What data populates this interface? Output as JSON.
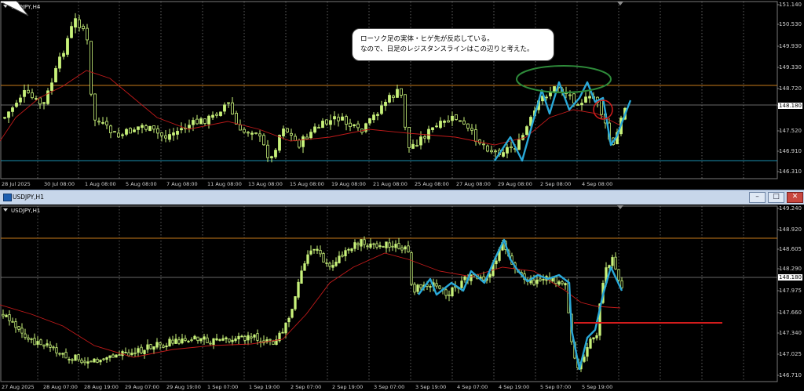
{
  "window_top": {
    "symbol_title": "USDJPY,H4",
    "y_labels": [
      "151.140",
      "150.530",
      "149.930",
      "149.330",
      "148.720",
      "148.180",
      "147.520",
      "146.910",
      "146.310"
    ],
    "current_price": "148.180",
    "x_labels": [
      "28 Jul 2025",
      "30 Jul 08:00",
      "1 Aug 08:00",
      "5 Aug 08:00",
      "7 Aug 08:00",
      "11 Aug 08:00",
      "13 Aug 08:00",
      "15 Aug 08:00",
      "19 Aug 08:00",
      "21 Aug 08:00",
      "25 Aug 08:00",
      "27 Aug 08:00",
      "29 Aug 08:00",
      "2 Sep 08:00",
      "4 Sep 08:00"
    ],
    "annotation_lines": [
      "ローソク足の実体・ヒゲ先が反応している。",
      "なので、日足のレジスタンスラインはこの辺りと考えた。"
    ]
  },
  "window_bottom": {
    "title_bar": "USDJPY,H1",
    "symbol_title": "USDJPY,H1",
    "y_labels": [
      "149.240",
      "148.920",
      "148.605",
      "148.290",
      "147.975",
      "147.660",
      "147.340",
      "147.025",
      "146.710"
    ],
    "current_price": "148.180",
    "x_labels": [
      "27 Aug 2025",
      "28 Aug 07:00",
      "28 Aug 19:00",
      "29 Aug 07:00",
      "29 Aug 19:00",
      "1 Sep 07:00",
      "1 Sep 19:00",
      "2 Sep 07:00",
      "2 Sep 19:00",
      "3 Sep 07:00",
      "3 Sep 19:00",
      "4 Sep 07:00",
      "4 Sep 19:00",
      "5 Sep 07:00",
      "5 Sep 19:00"
    ],
    "buttons": {
      "minimize": "–",
      "maximize": "□",
      "close": "✕"
    }
  },
  "colors": {
    "candle": "#c8f27a",
    "moving_average": "#c21a1a",
    "resistance_line": "#c87a1a",
    "support_line": "#1a8fb0",
    "trace": "#29a8d8",
    "horizontal_marker": "#d21c1c",
    "ellipse": "#2e8b3a",
    "circle": "#d21c1c"
  }
}
